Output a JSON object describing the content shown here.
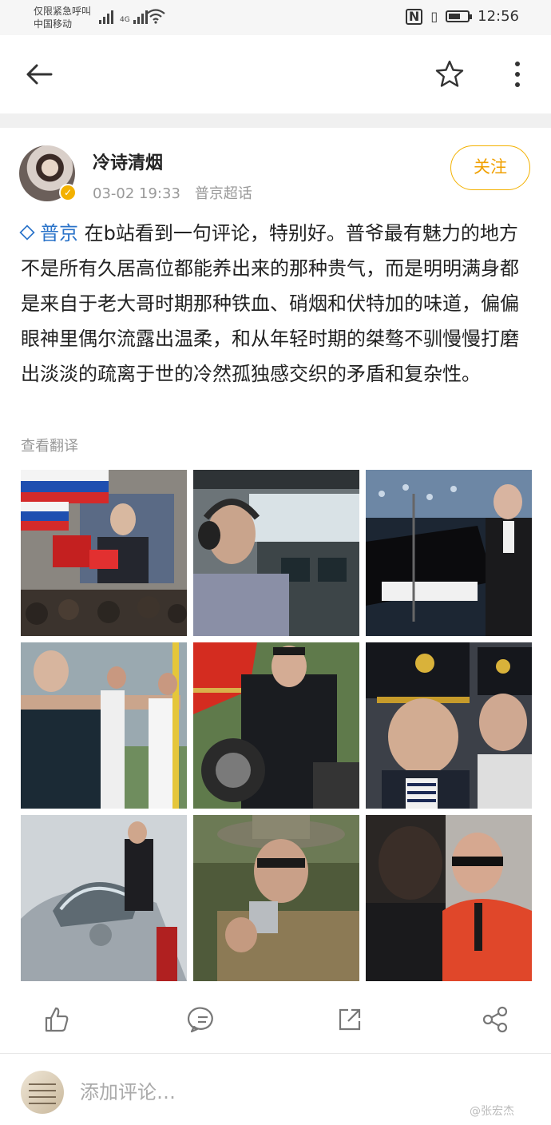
{
  "status_bar": {
    "carrier_line1": "仅限紧急呼叫",
    "carrier_line2": "中国移动",
    "network": "4G",
    "time": "12:56"
  },
  "nav": {
    "back_icon": "arrow-left-icon",
    "star_icon": "star-outline-icon",
    "more_icon": "more-vertical-icon"
  },
  "post": {
    "username": "冷诗清烟",
    "timestamp": "03-02 19:33",
    "source": "普京超话",
    "follow_label": "关注",
    "topic": "普京",
    "body": " 在b站看到一句评论，特别好。普爷最有魅力的地方不是所有久居高位都能养出来的那种贵气，而是明明满身都是来自于老大哥时期那种铁血、硝烟和伏特加的味道，偏偏眼神里偶尔流露出温柔，和从年轻时期的桀骜不驯慢慢打磨出淡淡的疏离于世的冷然孤独感交织的矛盾和复杂性。",
    "translate_label": "查看翻译"
  },
  "colors": {
    "accent_gold": "#f3b100",
    "topic_blue": "#2a73c9",
    "meta_gray": "#999999"
  },
  "actions": {
    "like_icon": "thumbs-up-icon",
    "comment_icon": "comment-icon",
    "repost_icon": "repost-icon",
    "share_icon": "share-icon"
  },
  "comment_bar": {
    "placeholder": "添加评论…"
  },
  "watermark": "@张宏杰"
}
